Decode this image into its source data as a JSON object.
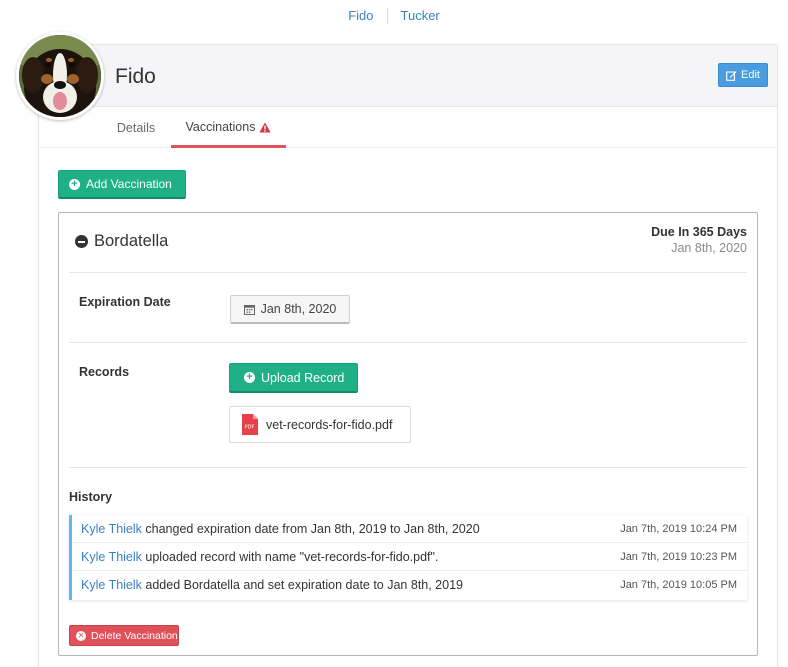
{
  "pet_nav": {
    "items": [
      "Fido",
      "Tucker"
    ]
  },
  "pet": {
    "name": "Fido",
    "edit_label": "Edit",
    "avatar_icon": "dog-photo"
  },
  "tabs": [
    {
      "label": "Details",
      "active": false
    },
    {
      "label": "Vaccinations",
      "active": true,
      "warning_icon": "warning-triangle-icon"
    }
  ],
  "add_vaccination_label": "Add Vaccination",
  "vaccination": {
    "name": "Bordatella",
    "due_label": "Due In 365 Days",
    "due_date": "Jan 8th, 2020",
    "expiration_label": "Expiration Date",
    "expiration_value": "Jan 8th, 2020",
    "records_label": "Records",
    "upload_label": "Upload Record",
    "files": [
      "vet-records-for-fido.pdf"
    ],
    "history_label": "History",
    "history": [
      {
        "user": "Kyle Thielk",
        "text": " changed expiration date from Jan 8th, 2019 to Jan 8th, 2020",
        "time": "Jan 7th, 2019 10:24 PM"
      },
      {
        "user": "Kyle Thielk",
        "text": " uploaded record with name \"vet-records-for-fido.pdf\".",
        "time": "Jan 7th, 2019 10:23 PM"
      },
      {
        "user": "Kyle Thielk",
        "text": " added Bordatella and set expiration date to Jan 8th, 2019",
        "time": "Jan 7th, 2019 10:05 PM"
      }
    ],
    "delete_label": "Delete Vaccination"
  },
  "colors": {
    "link": "#3b80c6",
    "green": "#1fb088",
    "danger": "#e0515a",
    "edit_blue": "#4a9ce0",
    "history_accent": "#63b8e6"
  }
}
